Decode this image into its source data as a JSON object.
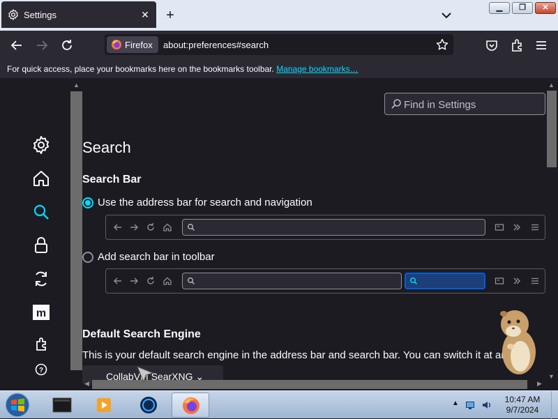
{
  "tab": {
    "label": "Settings",
    "close": "✕",
    "new_tab": "+"
  },
  "window_controls": {
    "minimize": "▁",
    "maximize": "❐",
    "close": "✕"
  },
  "navbar": {
    "identity_label": "Firefox",
    "url": "about:preferences#search"
  },
  "bookmarks_bar": {
    "text": "For quick access, place your bookmarks here on the bookmarks toolbar.",
    "link": "Manage bookmarks…"
  },
  "find": {
    "placeholder": "Find in Settings"
  },
  "search_page": {
    "title": "Search",
    "search_bar_heading": "Search Bar",
    "option_address_bar": "Use the address bar for search and navigation",
    "option_toolbar": "Add search bar in toolbar",
    "selected_option": "address_bar",
    "default_engine_heading": "Default Search Engine",
    "default_engine_desc": "This is your default search engine in the address bar and search bar. You can switch it at any",
    "engine_select_value": "CollabVM SearXNG"
  },
  "sidebar": [
    "settings-icon",
    "home-icon",
    "search-icon",
    "lock-icon",
    "sync-icon",
    "more-from-mozilla-icon",
    "extensions-icon",
    "help-icon"
  ],
  "taskbar": {
    "time": "10:47 AM",
    "date": "9/7/2024"
  },
  "colors": {
    "accent": "#00ddff",
    "background": "#1c1b22",
    "toolbar": "#2b2a33",
    "field_focus": "#0060df"
  }
}
